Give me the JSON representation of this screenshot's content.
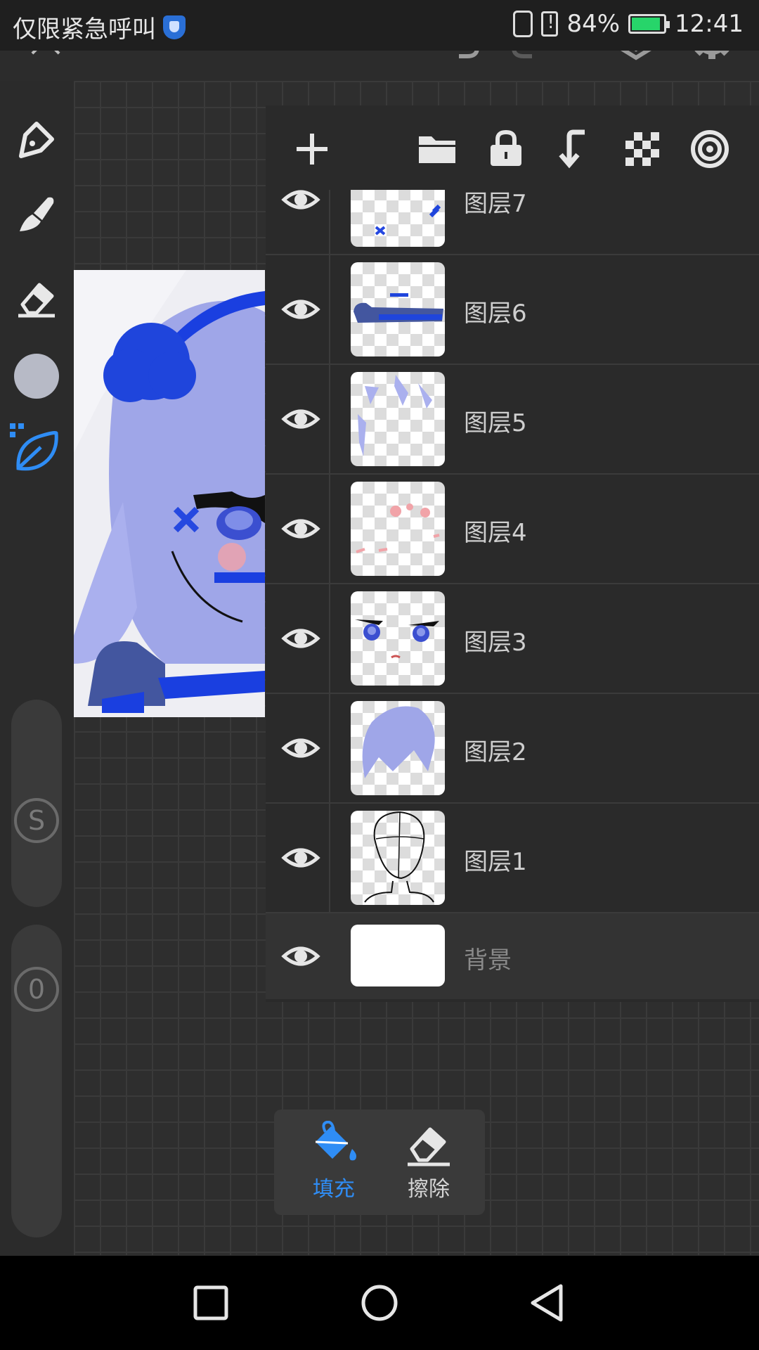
{
  "status_bar": {
    "carrier_text": "仅限紧急呼叫",
    "battery_percent": "84%",
    "battery_level": 0.84,
    "time": "12:41"
  },
  "toolbar": {
    "icons": [
      "close-icon",
      "undo-icon",
      "redo-icon",
      "layers-icon",
      "settings-icon"
    ]
  },
  "left_tools": {
    "icons": [
      "pen-tool-icon",
      "brush-tool-icon",
      "eraser-tool-icon",
      "color-swatch",
      "leaf-tool-icon"
    ],
    "size_label": "S",
    "opacity_label": "0"
  },
  "layers_panel": {
    "header_icons": [
      "add-icon",
      "folder-icon",
      "lock-icon",
      "merge-down-icon",
      "transparency-icon",
      "target-icon"
    ],
    "layers": [
      {
        "name": "图层7"
      },
      {
        "name": "图层6"
      },
      {
        "name": "图层5"
      },
      {
        "name": "图层4"
      },
      {
        "name": "图层3"
      },
      {
        "name": "图层2"
      },
      {
        "name": "图层1"
      }
    ],
    "background": {
      "name": "背景"
    }
  },
  "fill_tools": {
    "fill_label": "填充",
    "erase_label": "擦除"
  },
  "colors": {
    "accent": "#2f8df5",
    "battery_fill": "#27d56a"
  }
}
